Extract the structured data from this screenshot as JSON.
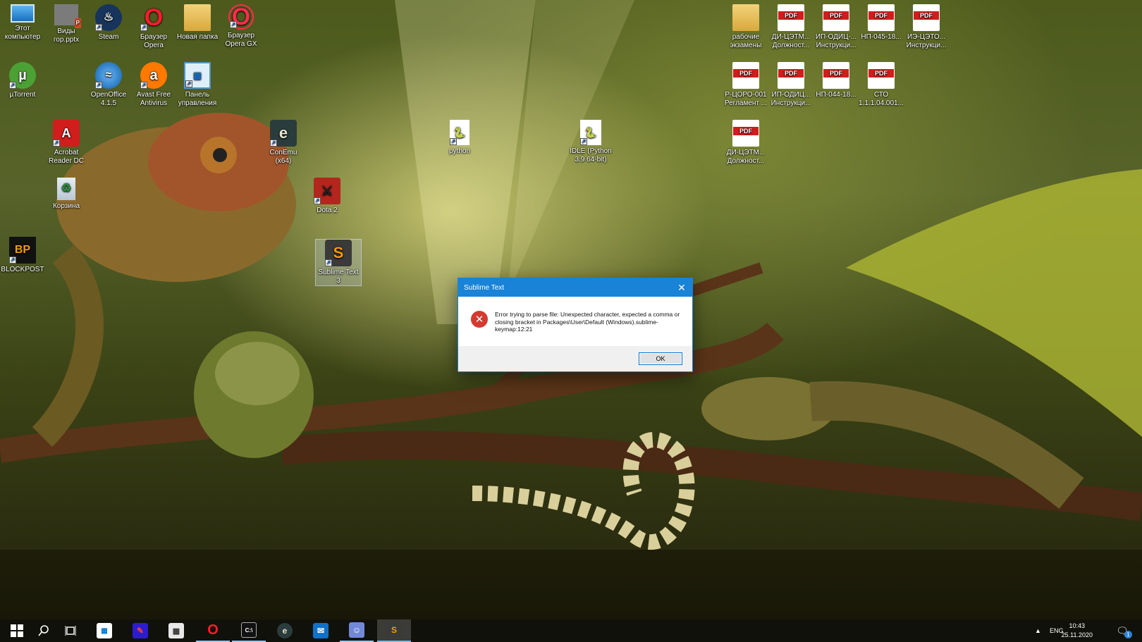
{
  "desktop": {
    "left_icons": [
      {
        "name": "this-pc-icon",
        "label": "Этот\nкомпьютер",
        "type": "pc"
      },
      {
        "name": "vidy-gor-pptx-icon",
        "label": "Виды\nгор.pptx",
        "type": "pptx"
      },
      {
        "name": "steam-icon",
        "label": "Steam",
        "type": "steam"
      },
      {
        "name": "opera-browser-icon",
        "label": "Браузер\nOpera",
        "type": "opera"
      },
      {
        "name": "new-folder-icon",
        "label": "Новая папка",
        "type": "folder"
      },
      {
        "name": "opera-gx-icon",
        "label": "Браузер\nOpera GX",
        "type": "operagx"
      },
      {
        "name": "utorrent-icon",
        "label": "µTorrent",
        "type": "utorrent"
      },
      {
        "name": "openoffice-icon",
        "label": "OpenOffice\n4.1.5",
        "type": "openoffice"
      },
      {
        "name": "avast-icon",
        "label": "Avast Free\nAntivirus",
        "type": "avast"
      },
      {
        "name": "control-panel-icon",
        "label": "Панель\nуправления",
        "type": "panel"
      },
      {
        "name": "acrobat-reader-icon",
        "label": "Acrobat\nReader DC",
        "type": "acrobat"
      },
      {
        "name": "conemu-icon",
        "label": "ConEmu\n(x64)",
        "type": "conemu"
      },
      {
        "name": "python-icon",
        "label": "python",
        "type": "pyfile"
      },
      {
        "name": "idle-python-icon",
        "label": "IDLE (Python\n3.9 64-bit)",
        "type": "idle"
      },
      {
        "name": "recycle-bin-icon",
        "label": "Корзина",
        "type": "bin"
      },
      {
        "name": "dota2-icon",
        "label": "Dota 2",
        "type": "dota"
      },
      {
        "name": "blockpost-icon",
        "label": "BLOCKPOST",
        "type": "blockpost"
      },
      {
        "name": "sublime-text-icon",
        "label": "Sublime Text\n3",
        "type": "sublime"
      }
    ],
    "right_icons": [
      {
        "name": "exam-folder-icon",
        "label": "рабочие\nэкзамены",
        "type": "folder"
      },
      {
        "name": "pdf-di-cetm-1-icon",
        "label": "ДИ-ЦЭТМ...\nДолжност...",
        "type": "pdf"
      },
      {
        "name": "pdf-ip-odic-1-icon",
        "label": "ИП-ОДИЦ-...\nИнструкци...",
        "type": "pdf"
      },
      {
        "name": "pdf-np-045-icon",
        "label": "НП-045-18...",
        "type": "pdf"
      },
      {
        "name": "pdf-ie-ceto-icon",
        "label": "ИЭ-ЦЭТО...\nИнструкци...",
        "type": "pdf"
      },
      {
        "name": "pdf-r-coro-icon",
        "label": "Р-ЦОРО-001\nРегламент ...",
        "type": "pdf"
      },
      {
        "name": "pdf-ip-odic-2-icon",
        "label": "ИП-ОДИЦ...\nИнструкци...",
        "type": "pdf"
      },
      {
        "name": "pdf-np-044-icon",
        "label": "НП-044-18...",
        "type": "pdf"
      },
      {
        "name": "pdf-sto-icon",
        "label": "СТО\n1.1.1.04.001...",
        "type": "pdf"
      },
      {
        "name": "pdf-di-cetm-2-icon",
        "label": "ДИ-ЦЭТМ...\nДолжност...",
        "type": "pdf"
      }
    ]
  },
  "dialog": {
    "title": "Sublime Text",
    "message": "Error trying to parse file: Unexpected character, expected a comma or closing bracket in Packages\\User\\Default (Windows).sublime-keymap:12:21",
    "ok_label": "OK",
    "close_glyph": "✕"
  },
  "taskbar": {
    "language": "ENG",
    "time": "10:43",
    "date": "25.11.2020",
    "notification_count": "1"
  },
  "colors": {
    "dialog_title": "#1883d7",
    "error_icon": "#d43a2f",
    "taskbar": "#10100c"
  }
}
